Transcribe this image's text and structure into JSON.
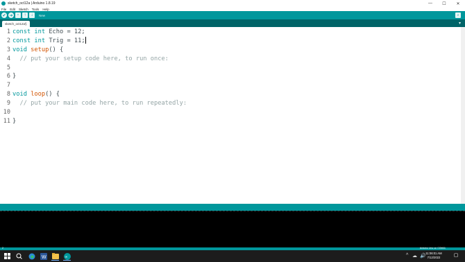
{
  "window": {
    "title": "sketch_oct12a | Arduino 1.8.19",
    "controls": {
      "minimize": "—",
      "maximize": "☐",
      "close": "✕"
    }
  },
  "menu": {
    "items": [
      "File",
      "Edit",
      "Sketch",
      "Tools",
      "Help"
    ]
  },
  "toolbar": {
    "hint": "New",
    "buttons": [
      {
        "name": "verify-icon",
        "glyph": "✔"
      },
      {
        "name": "upload-icon",
        "glyph": "➜"
      },
      {
        "name": "new-icon",
        "glyph": "▫"
      },
      {
        "name": "open-icon",
        "glyph": "↑"
      },
      {
        "name": "save-icon",
        "glyph": "↓"
      }
    ],
    "serial_monitor_glyph": "⌕"
  },
  "tabs": {
    "active": "sketch_oct12a§",
    "menu_glyph": "▾"
  },
  "editor": {
    "lines": [
      {
        "n": "1",
        "text": "const int Echo = 12;"
      },
      {
        "n": "2",
        "text": "const int Trig = 11;"
      },
      {
        "n": "3",
        "text": "void setup() {"
      },
      {
        "n": "4",
        "text": "  // put your setup code here, to run once:"
      },
      {
        "n": "5",
        "text": ""
      },
      {
        "n": "6",
        "text": "}"
      },
      {
        "n": "7",
        "text": ""
      },
      {
        "n": "8",
        "text": "void loop() {"
      },
      {
        "n": "9",
        "text": "  // put your main code here, to run repeatedly:"
      },
      {
        "n": "10",
        "text": ""
      },
      {
        "n": "11",
        "text": "}"
      }
    ]
  },
  "bottom": {
    "line_no": "2",
    "board": "Arduino Uno on COM11"
  },
  "taskbar": {
    "icons": [
      "windows-start-icon",
      "search-icon",
      "edge-icon",
      "word-icon",
      "file-explorer-icon",
      "arduino-icon"
    ],
    "tray": [
      "^",
      "☁",
      "🔊"
    ],
    "time": "11:06:01 AM",
    "date": "7/12/2022",
    "notify_glyph": "▢"
  },
  "colors": {
    "accent": "#00979c",
    "tab_bar": "#006468",
    "keyword": "#00979c",
    "function": "#d35400",
    "comment": "#95a5a6"
  }
}
